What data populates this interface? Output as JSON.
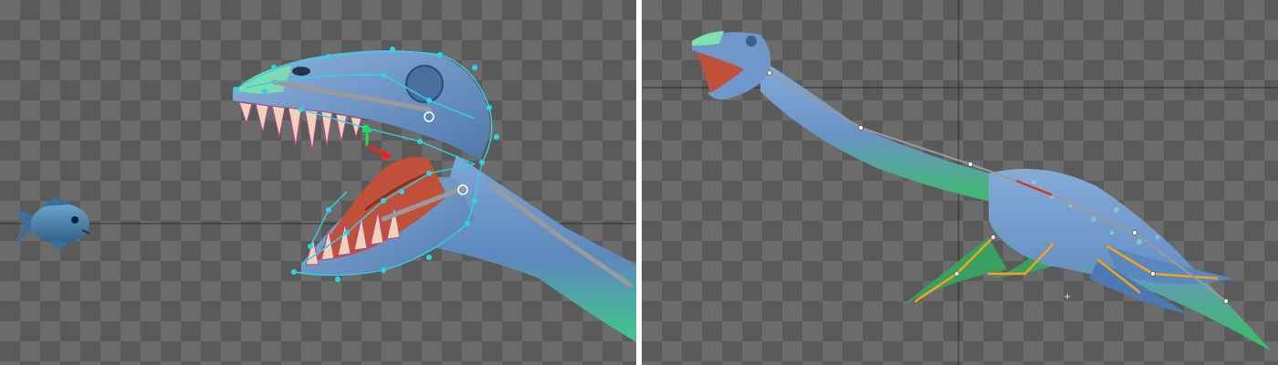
{
  "app": {
    "title": ""
  },
  "viewports": {
    "left": {
      "name": "head-rig-edit-view"
    },
    "right": {
      "name": "full-body-rig-view"
    }
  },
  "colors": {
    "checker_light": "#6b6b6b",
    "checker_dark": "#5a5a5a",
    "body_blue": "#6f97c9",
    "belly_green": "#3fbf6a",
    "mouth_red": "#c0503a",
    "mesh_cyan": "#29d6e6",
    "bone_orange": "#f2a516",
    "bone_gray": "#8e8e8e"
  }
}
